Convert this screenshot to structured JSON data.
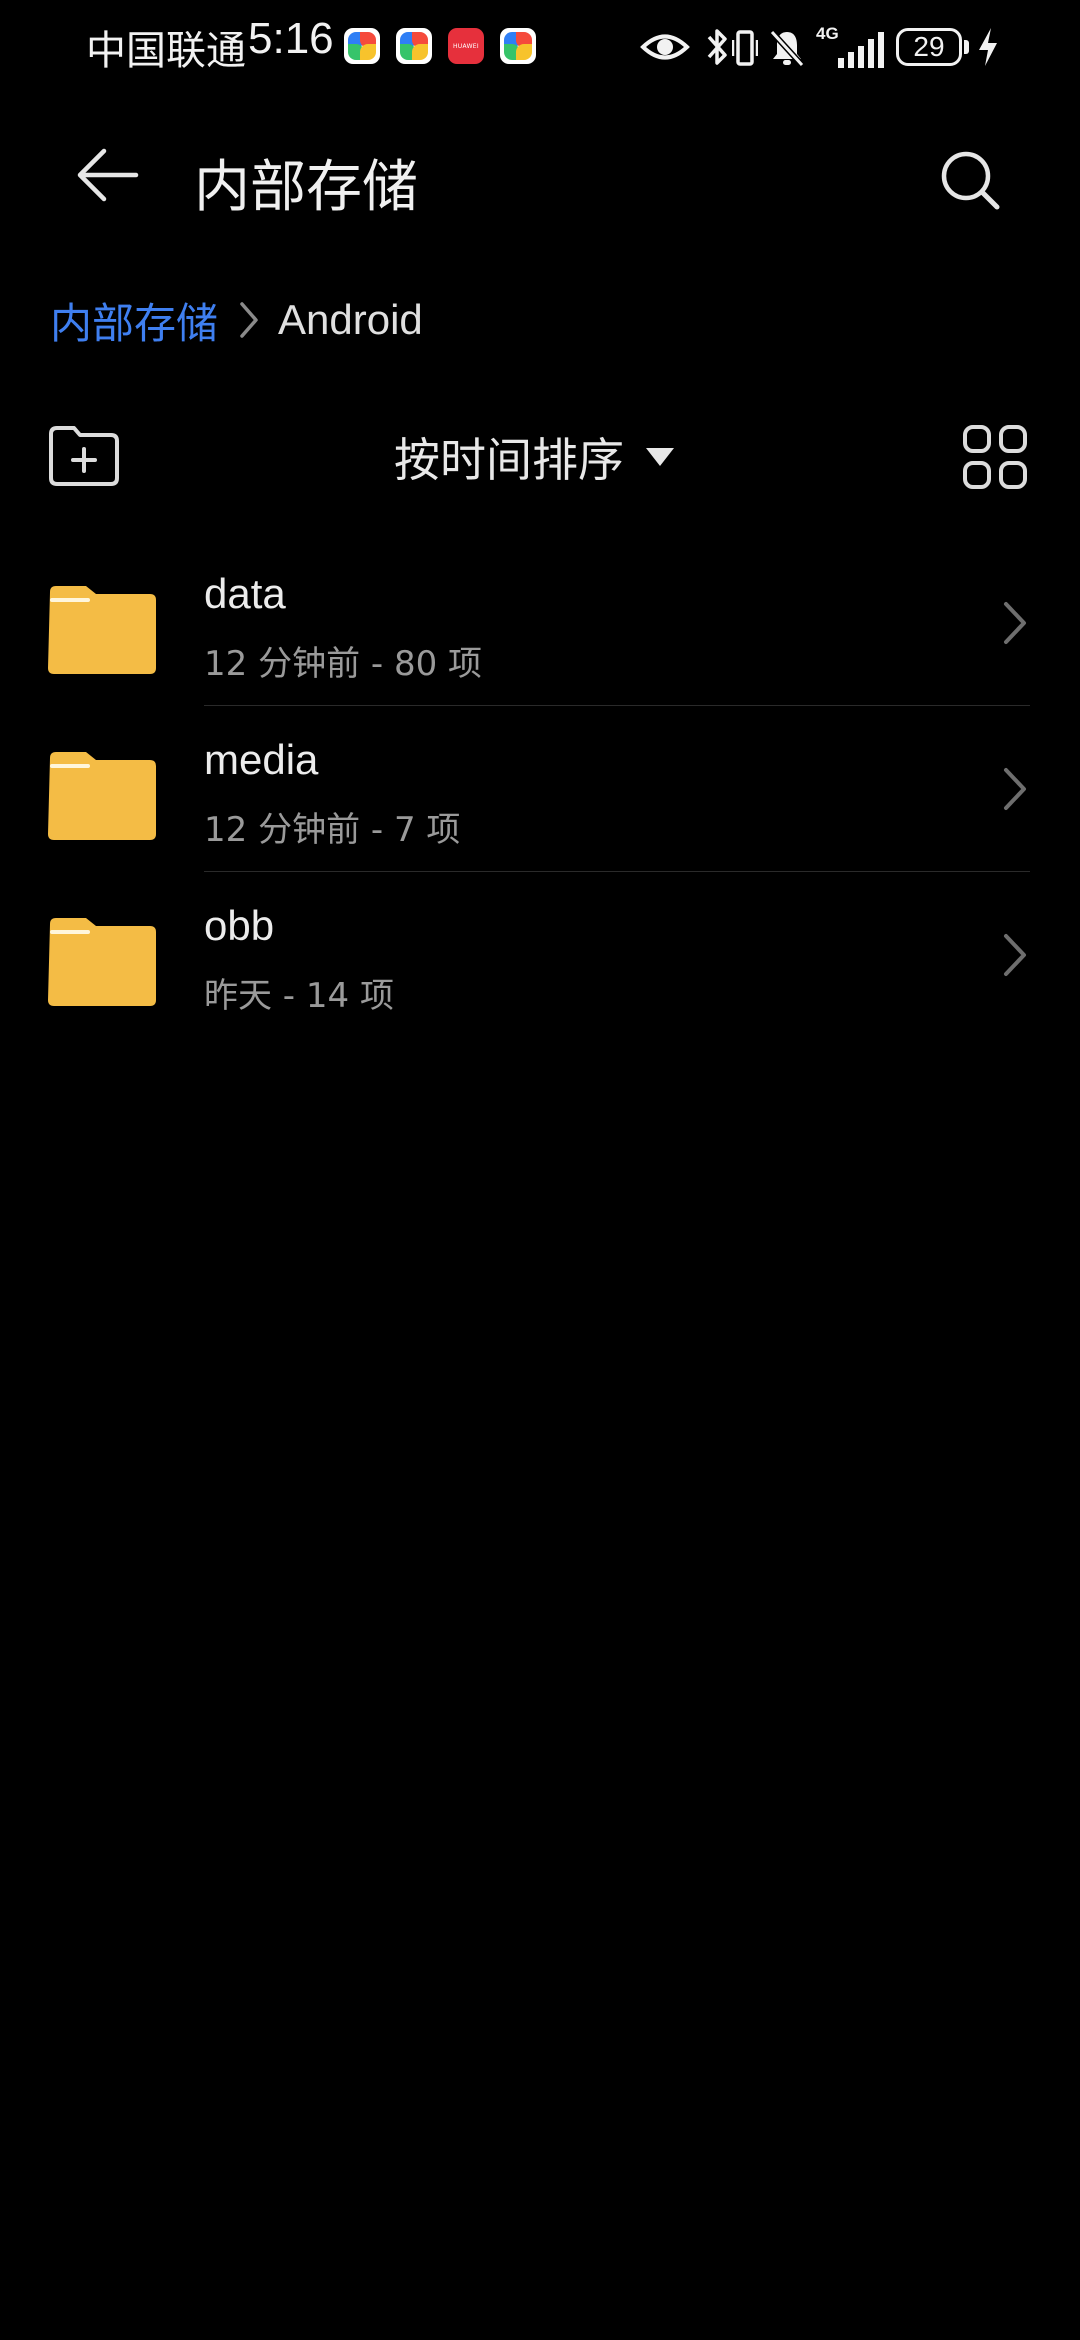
{
  "status_bar": {
    "carrier": "中国联通",
    "time": "5:16",
    "network": "4G",
    "battery": "29",
    "huawei_badge": "HUAWEI"
  },
  "app_bar": {
    "title": "内部存储",
    "icons": {
      "back": "back-arrow-icon",
      "search": "search-icon"
    }
  },
  "breadcrumb": {
    "root": "内部存储",
    "current": "Android"
  },
  "toolbar": {
    "sort_label": "按时间排序",
    "icons": {
      "new_folder": "new-folder-icon",
      "view": "grid-view-icon"
    }
  },
  "files": [
    {
      "name": "data",
      "meta": "12 分钟前 - 80 项"
    },
    {
      "name": "media",
      "meta": "12 分钟前 - 7 项"
    },
    {
      "name": "obb",
      "meta": "昨天 - 14 项"
    }
  ],
  "colors": {
    "background": "#000000",
    "accent": "#3f7ff0",
    "folder": "#f4bc45",
    "text_primary": "#ececec",
    "text_secondary": "#9a9a9a"
  }
}
